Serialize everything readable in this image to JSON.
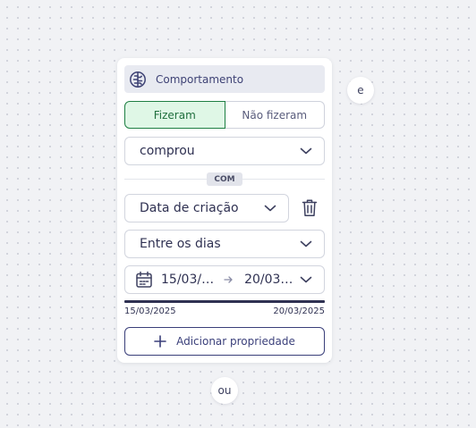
{
  "colors": {
    "accent": "#3a3f7a",
    "active_bg": "#dff7e6",
    "active_border": "#1e7f43",
    "header_bg": "#e8eaf1"
  },
  "filter_card": {
    "header": {
      "icon": "brain-icon",
      "title": "Comportamento"
    },
    "toggle": {
      "did": "Fizeram",
      "did_not": "Não fizeram",
      "selected": "Fizeram"
    },
    "event_select": {
      "value": "comprou"
    },
    "connector": "COM",
    "property_select": {
      "value": "Data de criação"
    },
    "operator_select": {
      "value": "Entre os dias"
    },
    "date_range": {
      "from": "15/03/…",
      "to": "20/03…"
    },
    "slider": {
      "min_label": "15/03/2025",
      "max_label": "20/03/2025"
    },
    "add_property_button": "Adicionar propriedade"
  },
  "connectors": {
    "and_label": "e",
    "or_label": "ou"
  }
}
